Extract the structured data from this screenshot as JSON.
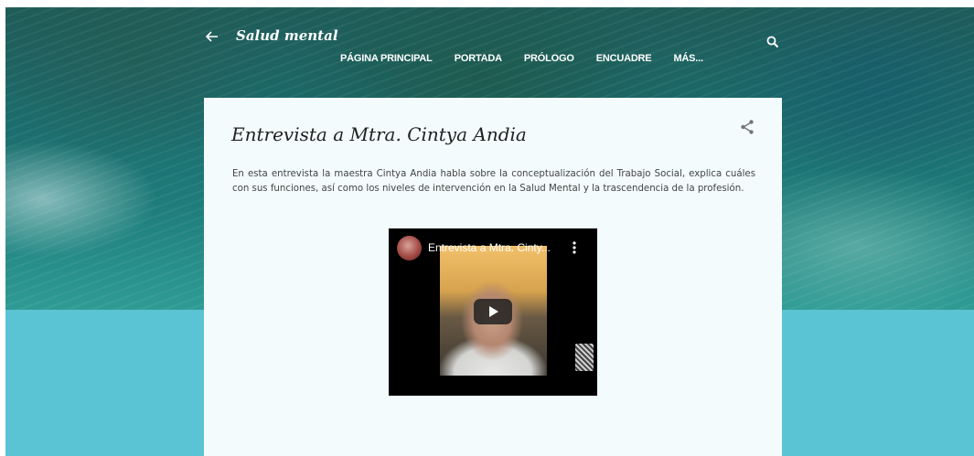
{
  "header": {
    "blog_title": "Salud mental",
    "nav": [
      {
        "label": "PÁGINA PRINCIPAL"
      },
      {
        "label": "PORTADA"
      },
      {
        "label": "PRÓLOGO"
      },
      {
        "label": "ENCUADRE"
      },
      {
        "label": "MÁS..."
      }
    ]
  },
  "post": {
    "title": "Entrevista a Mtra. Cintya Andia",
    "body": "En esta entrevista la maestra Cintya Andia habla sobre la conceptualización del Trabajo Social, explica cuáles con sus funciones, así como los niveles de intervención en la Salud Mental y la trascendencia de la profesión."
  },
  "video": {
    "title": "Entrevista a Mtra. Cinty..."
  },
  "icons": {
    "back": "arrow-left-icon",
    "search": "search-icon",
    "share": "share-icon",
    "more": "kebab-menu-icon",
    "play": "play-icon"
  },
  "colors": {
    "card_background": "#f3fbfc",
    "teal_band": "#5bc4d4",
    "header_text": "#ffffff",
    "title_text": "#212121",
    "body_text": "#444444"
  }
}
